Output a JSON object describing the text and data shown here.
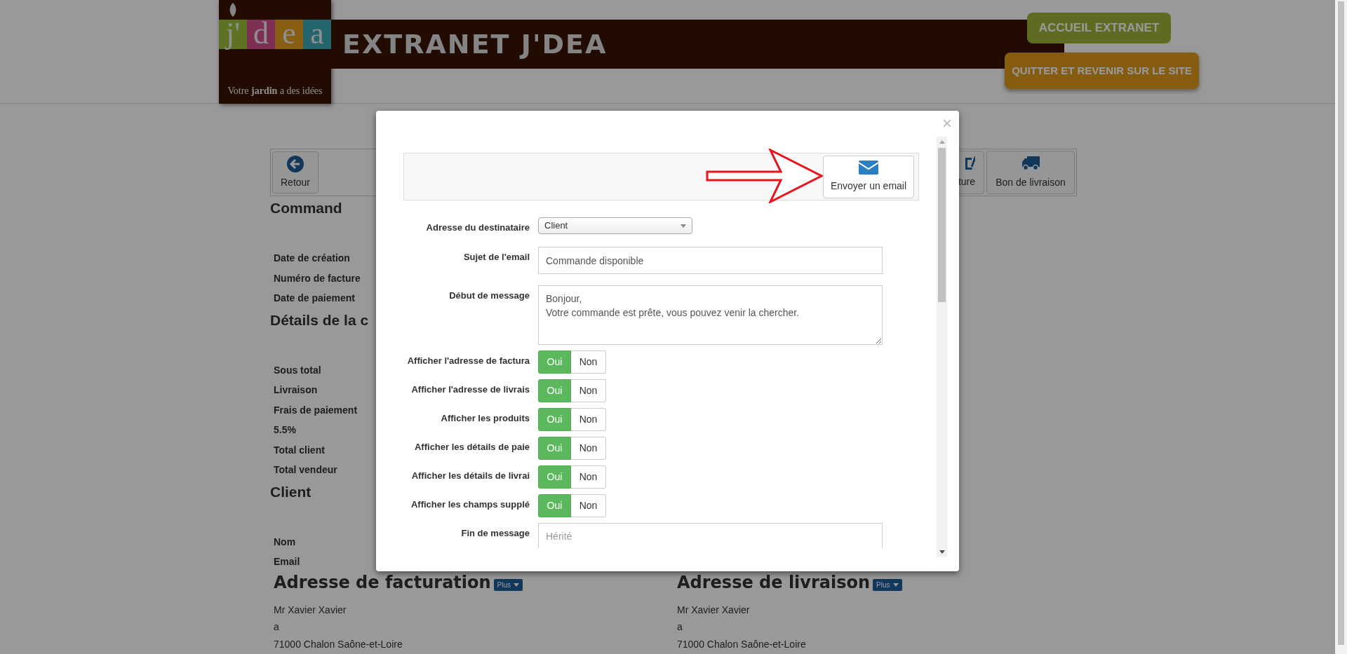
{
  "header": {
    "logo": {
      "letters": [
        {
          "text": "j'",
          "color": "#5d7323"
        },
        {
          "text": "d",
          "color": "#7e2f54"
        },
        {
          "text": "e",
          "color": "#885e14"
        },
        {
          "text": "a",
          "color": "#23646d"
        }
      ],
      "tagline": "Votre **jardin** a des idées"
    },
    "title": "EXTRANET J'DEA",
    "buttons": [
      {
        "label": "ACCUEIL EXTRANET",
        "kind": "home"
      },
      {
        "label": "QUITTER ET REVENIR SUR LE SITE",
        "kind": "exit"
      }
    ]
  },
  "page": {
    "toolbar": {
      "back": "Retour",
      "right_buttons": [
        {
          "label": "ture",
          "kind": "invoice"
        },
        {
          "label": "Bon de livraison",
          "kind": "delivery"
        }
      ]
    },
    "sections": [
      {
        "heading": "Command",
        "rows": [
          "Date de création",
          "Numéro de facture",
          "Date de paiement"
        ]
      },
      {
        "heading": "Détails de la c",
        "rows": [
          "Sous total",
          "Livraison",
          "Frais de paiement",
          "5.5%",
          "Total client",
          "Total vendeur"
        ]
      },
      {
        "heading": "Client",
        "rows": [
          "Nom",
          "Email"
        ]
      }
    ],
    "addresses": [
      {
        "heading": "Adresse de facturation",
        "menu": "Plus",
        "lines": [
          "Mr Xavier Xavier",
          "a",
          "71000 Chalon Saône-et-Loire"
        ]
      },
      {
        "heading": "Adresse de livraison",
        "menu": "Plus",
        "lines": [
          "Mr Xavier Xavier",
          "a",
          "71000 Chalon Saône-et-Loire"
        ]
      }
    ]
  },
  "modal": {
    "close": "×",
    "action": "Envoyer un email",
    "fields": [
      {
        "kind": "select",
        "label": "Adresse du destinataire",
        "value": "Client"
      },
      {
        "kind": "text",
        "label": "Sujet de l'email",
        "value": "Commande disponible"
      },
      {
        "kind": "textarea",
        "label": "Début de message",
        "value": "Bonjour,\nVotre commande est prête, vous pouvez venir la chercher."
      },
      {
        "kind": "toggle",
        "label": "Afficher l'adresse de factura",
        "on": true,
        "yes": "Oui",
        "no": "Non"
      },
      {
        "kind": "toggle",
        "label": "Afficher l'adresse de livrais",
        "on": true,
        "yes": "Oui",
        "no": "Non"
      },
      {
        "kind": "toggle",
        "label": "Afficher les produits",
        "on": true,
        "yes": "Oui",
        "no": "Non"
      },
      {
        "kind": "toggle",
        "label": "Afficher les détails de paie",
        "on": true,
        "yes": "Oui",
        "no": "Non"
      },
      {
        "kind": "toggle",
        "label": "Afficher les détails de livrai",
        "on": true,
        "yes": "Oui",
        "no": "Non"
      },
      {
        "kind": "toggle",
        "label": "Afficher les champs supplé",
        "on": true,
        "yes": "Oui",
        "no": "Non"
      },
      {
        "kind": "textarea_cut",
        "label": "Fin de message",
        "placeholder": "Hérité"
      }
    ]
  }
}
